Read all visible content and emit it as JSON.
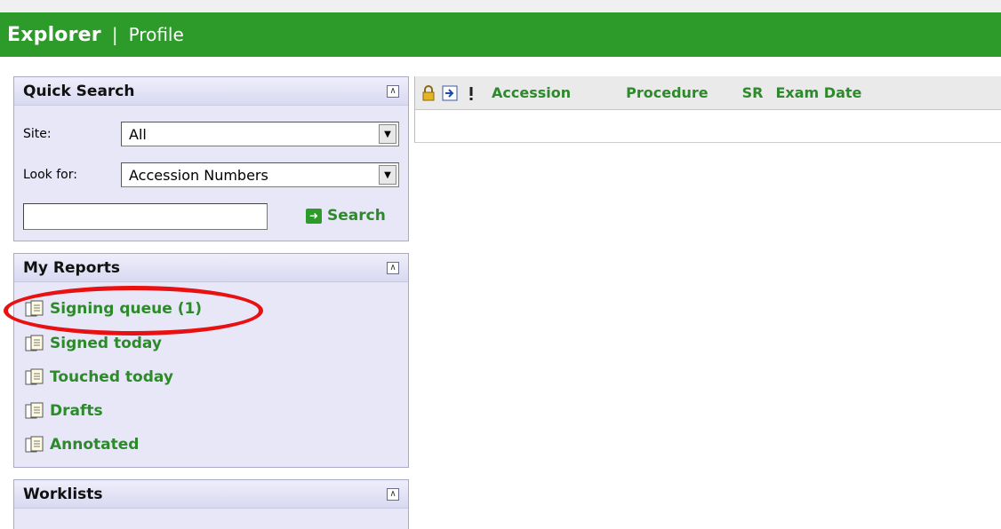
{
  "header": {
    "title": "Explorer",
    "separator": "|",
    "profile_link": "Profile"
  },
  "quick_search": {
    "title": "Quick Search",
    "site_label": "Site:",
    "site_value": "All",
    "lookfor_label": "Look for:",
    "lookfor_value": "Accession Numbers",
    "input_value": "",
    "search_label": "Search"
  },
  "my_reports": {
    "title": "My Reports",
    "items": [
      {
        "label": "Signing queue (1)"
      },
      {
        "label": "Signed today"
      },
      {
        "label": "Touched today"
      },
      {
        "label": "Drafts"
      },
      {
        "label": "Annotated"
      }
    ]
  },
  "worklists": {
    "title": "Worklists"
  },
  "grid": {
    "columns": [
      "Accession",
      "Procedure",
      "SR",
      "Exam Date"
    ]
  },
  "colors": {
    "brand_green": "#2d9b2a",
    "link_green": "#2d8a2a",
    "annotation_red": "#e81010",
    "panel_bg": "#e7e7f8"
  }
}
